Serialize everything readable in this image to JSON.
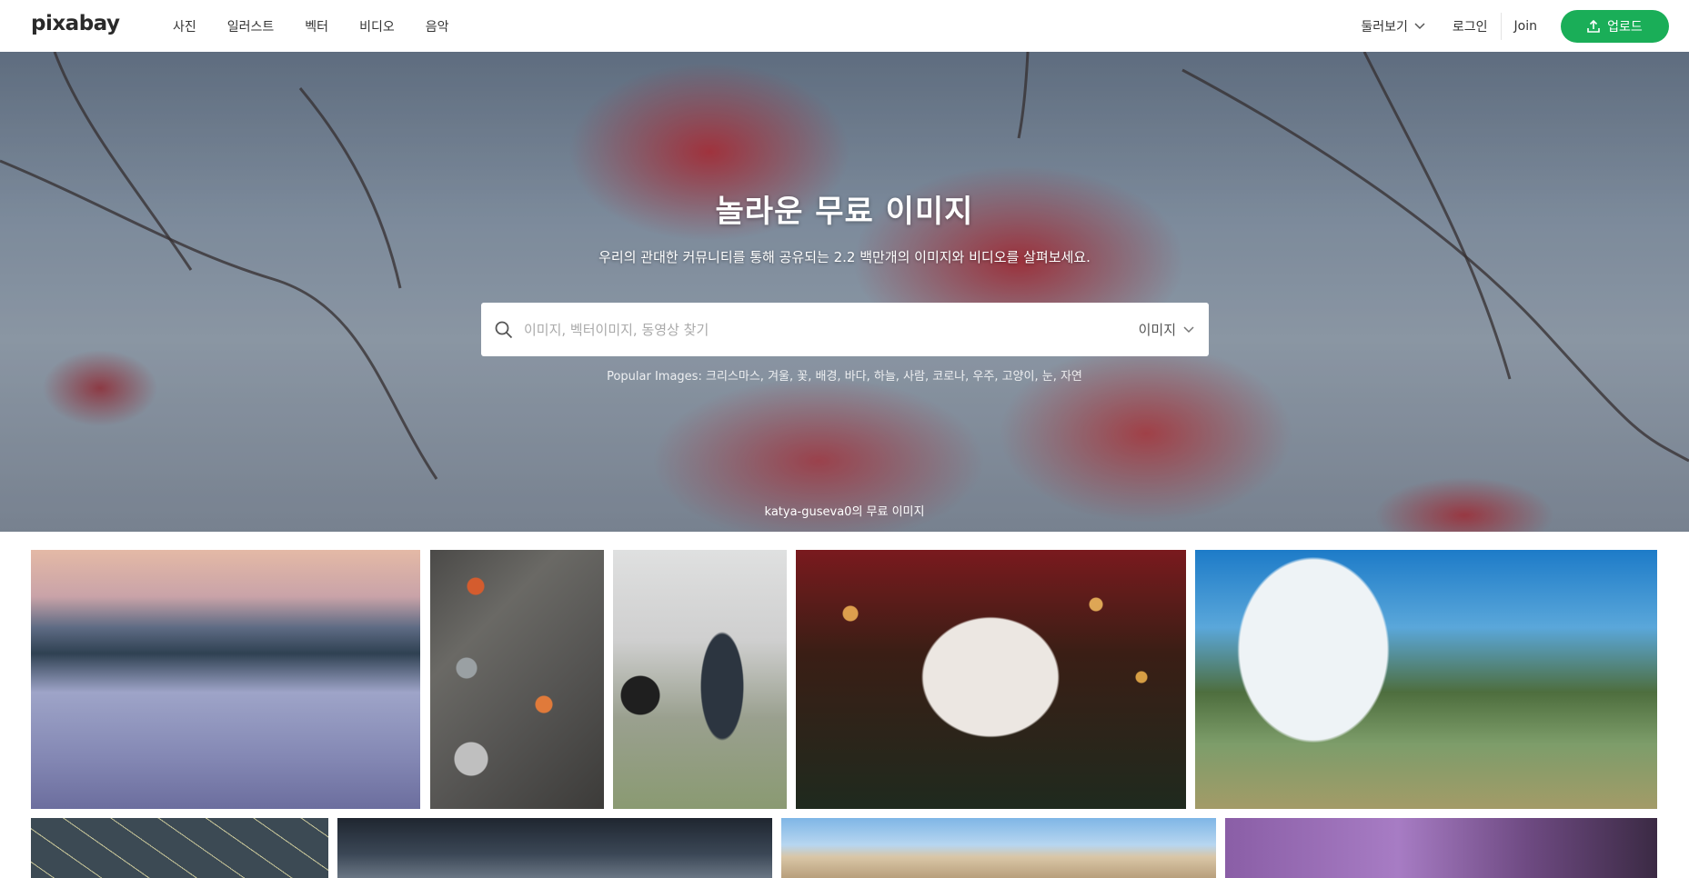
{
  "header": {
    "logo": "pixabay",
    "nav": [
      "사진",
      "일러스트",
      "벡터",
      "비디오",
      "음악"
    ],
    "explore_label": "둘러보기",
    "login_label": "로그인",
    "join_label": "Join",
    "upload_label": "업로드"
  },
  "hero": {
    "title": "놀라운 무료 이미지",
    "subtitle": "우리의 관대한 커뮤니티를 통해 공유되는 2.2 백만개의 이미지와 비디오를 살펴보세요.",
    "search": {
      "placeholder": "이미지, 벡터이미지, 동영상 찾기",
      "value": "",
      "type_selected": "이미지"
    },
    "popular_label": "Popular Images:",
    "popular_tags": [
      "크리스마스",
      "겨울",
      "꽃",
      "배경",
      "바다",
      "하늘",
      "사람",
      "코로나",
      "우주",
      "고양이",
      "눈",
      "자연"
    ],
    "credit": "katya-guseva0의 무료 이미지"
  },
  "colors": {
    "accent": "#1aae58",
    "text": "#333333"
  },
  "gallery": {
    "tiles": [
      "snowy-road-landscape",
      "christmas-ornaments-flatlay",
      "child-and-dog-in-snow",
      "hot-chocolate-mug",
      "frosted-tree-meadow",
      "pine-branch-pattern",
      "dark-snowy-scene",
      "colosseum-arches",
      "purple-wall-window"
    ]
  }
}
